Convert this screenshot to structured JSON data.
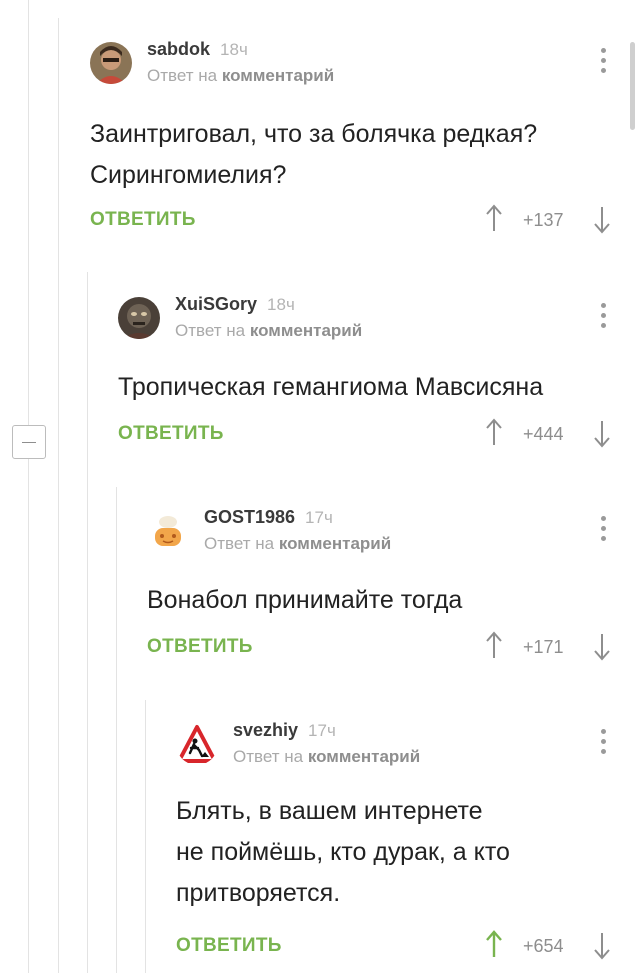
{
  "comments": [
    {
      "author": "sabdok",
      "time": "18ч",
      "reply_prefix": "Ответ на",
      "reply_link": "комментарий",
      "lines": [
        "Заинтриговал, что за болячка редкая?",
        "Сирингомиелия?"
      ],
      "reply_label": "ОТВЕТИТЬ",
      "score": "+137",
      "upvoted": false
    },
    {
      "author": "XuiSGory",
      "time": "18ч",
      "reply_prefix": "Ответ на",
      "reply_link": "комментарий",
      "lines": [
        "Тропическая гемангиома Мавсисяна"
      ],
      "reply_label": "ОТВЕТИТЬ",
      "score": "+444",
      "upvoted": false
    },
    {
      "author": "GOST1986",
      "time": "17ч",
      "reply_prefix": "Ответ на",
      "reply_link": "комментарий",
      "lines": [
        "Вонабол принимайте тогда"
      ],
      "reply_label": "ОТВЕТИТЬ",
      "score": "+171",
      "upvoted": false
    },
    {
      "author": "svezhiy",
      "time": "17ч",
      "reply_prefix": "Ответ на",
      "reply_link": "комментарий",
      "lines": [
        "Блять, в вашем интернете",
        "не поймёшь, кто дурак, а кто",
        "притворяется."
      ],
      "reply_label": "ОТВЕТИТЬ",
      "score": "+654",
      "upvoted": true
    }
  ],
  "colors": {
    "accent_green": "#79b44f",
    "muted": "#9a9a9a",
    "thread_line": "#e3e3e3"
  },
  "icons": {
    "vote_up": "arrow-up-icon",
    "vote_down": "arrow-down-icon",
    "menu": "more-vertical-icon",
    "collapse": "minus-icon"
  }
}
